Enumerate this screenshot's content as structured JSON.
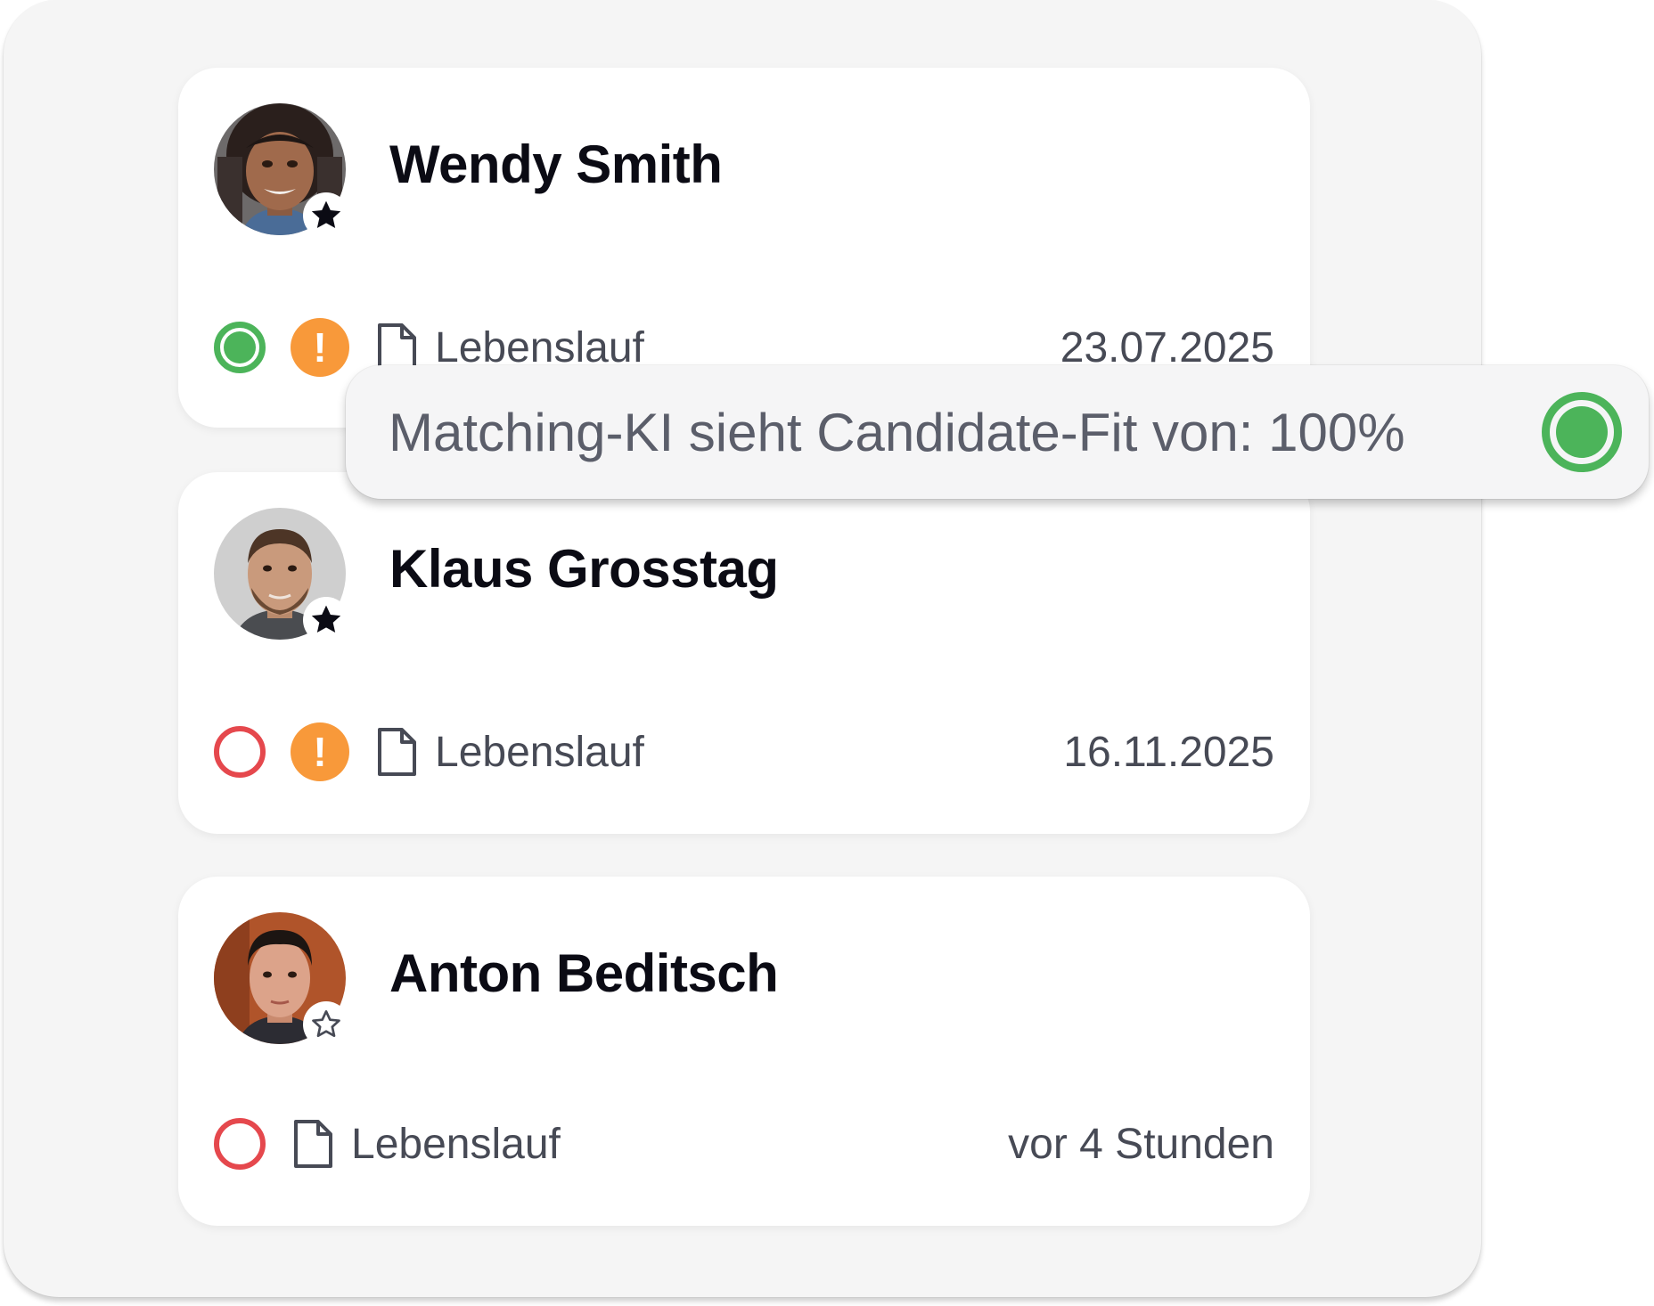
{
  "candidates": [
    {
      "name": "Wendy Smith",
      "favorite": true,
      "match_status": "match",
      "warning": "!",
      "document_label": "Lebenslauf",
      "date": "23.07.2025"
    },
    {
      "name": "Klaus Grosstag",
      "favorite": true,
      "match_status": "no-match",
      "warning": "!",
      "document_label": "Lebenslauf",
      "date": "16.11.2025"
    },
    {
      "name": "Anton Beditsch",
      "favorite": false,
      "match_status": "no-match",
      "document_label": "Lebenslauf",
      "date": "vor 4 Stunden"
    }
  ],
  "tooltip": {
    "text": "Matching-KI sieht Candidate-Fit von: 100%"
  },
  "icons": {
    "favorite_filled": "star-filled-icon",
    "favorite_empty": "star-outline-icon",
    "match": "green-circle-icon",
    "no_match": "red-circle-icon",
    "warning": "exclamation-icon",
    "document": "document-icon"
  },
  "colors": {
    "match_green": "#4cb45a",
    "no_match_red": "#e5484d",
    "warning_orange": "#f8993a",
    "name_text": "#0b0b14",
    "meta_text": "#474a55"
  }
}
